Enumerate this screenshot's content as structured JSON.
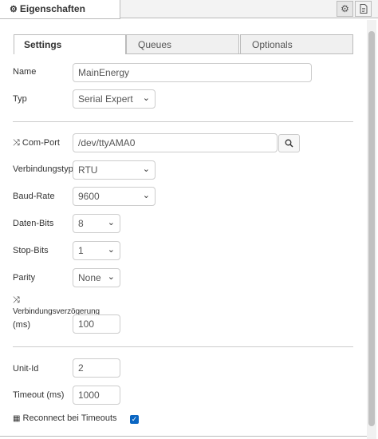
{
  "header": {
    "title": "Eigenschaften",
    "settings_icon": "gear-icon",
    "info_icon": "document-icon"
  },
  "tabs": [
    {
      "label": "Settings",
      "active": true
    },
    {
      "label": "Queues",
      "active": false
    },
    {
      "label": "Optionals",
      "active": false
    }
  ],
  "fields": {
    "name": {
      "label": "Name",
      "value": "MainEnergy"
    },
    "typ": {
      "label": "Typ",
      "value": "Serial Expert"
    },
    "comport": {
      "label": "Com-Port",
      "value": "/dev/ttyAMA0"
    },
    "verbindungstyp": {
      "label": "Verbindungstyp",
      "value": "RTU"
    },
    "baudrate": {
      "label": "Baud-Rate",
      "value": "9600"
    },
    "datenbits": {
      "label": "Daten-Bits",
      "value": "8"
    },
    "stopbits": {
      "label": "Stop-Bits",
      "value": "1"
    },
    "parity": {
      "label": "Parity",
      "value": "None"
    },
    "verzoegerung": {
      "label_line1": "Verbindungsverzögerung",
      "label_line2": "(ms)",
      "value": "100"
    },
    "unitid": {
      "label": "Unit-Id",
      "value": "2"
    },
    "timeout": {
      "label": "Timeout (ms)",
      "value": "1000"
    },
    "reconnect": {
      "label": "Reconnect bei Timeouts",
      "checked": true
    }
  },
  "icons": {
    "shuffle": "shuffle-icon",
    "search": "search-icon",
    "grid": "grid-icon"
  }
}
